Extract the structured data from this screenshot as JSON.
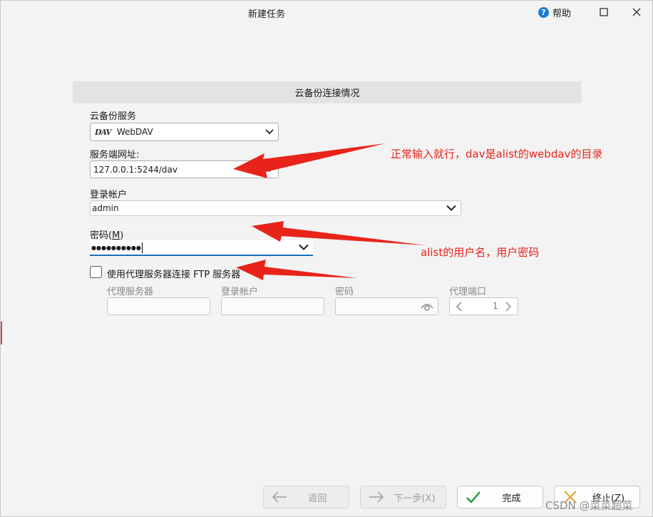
{
  "window": {
    "title": "新建任务",
    "help_label": "帮助"
  },
  "section": {
    "header": "云备份连接情况"
  },
  "form": {
    "service_label": "云备份服务",
    "service_logo": "DAV",
    "service_value": "WebDAV",
    "url_label": "服务端网址:",
    "url_value": "127.0.0.1:5244/dav",
    "account_label": "登录帐户",
    "account_value": "admin",
    "password_label": "密码(",
    "password_mnemonic": "M",
    "password_label_end": ")",
    "password_value": "●●●●●●●●●●",
    "proxy_checkbox_label": "使用代理服务器连接 FTP 服务器",
    "proxy_checked": false
  },
  "proxy": {
    "server_label": "代理服务器",
    "account_label": "登录帐户",
    "password_label": "密码",
    "port_label": "代理端口",
    "port_value": "1"
  },
  "buttons": {
    "back": "返回",
    "next": "下一步(X)",
    "finish": "完成",
    "cancel": "终止(Z)"
  },
  "annotations": {
    "url_note": "正常输入就行，dav是alist的webdav的目录",
    "account_note": "alist的用户名，用户密码"
  },
  "watermark": "CSDN @菜菜超菜",
  "colors": {
    "accent": "#1b7bd8",
    "annotation": "#e8231a",
    "finish_check": "#1e9a3c",
    "cancel_x": "#e8a33a"
  }
}
